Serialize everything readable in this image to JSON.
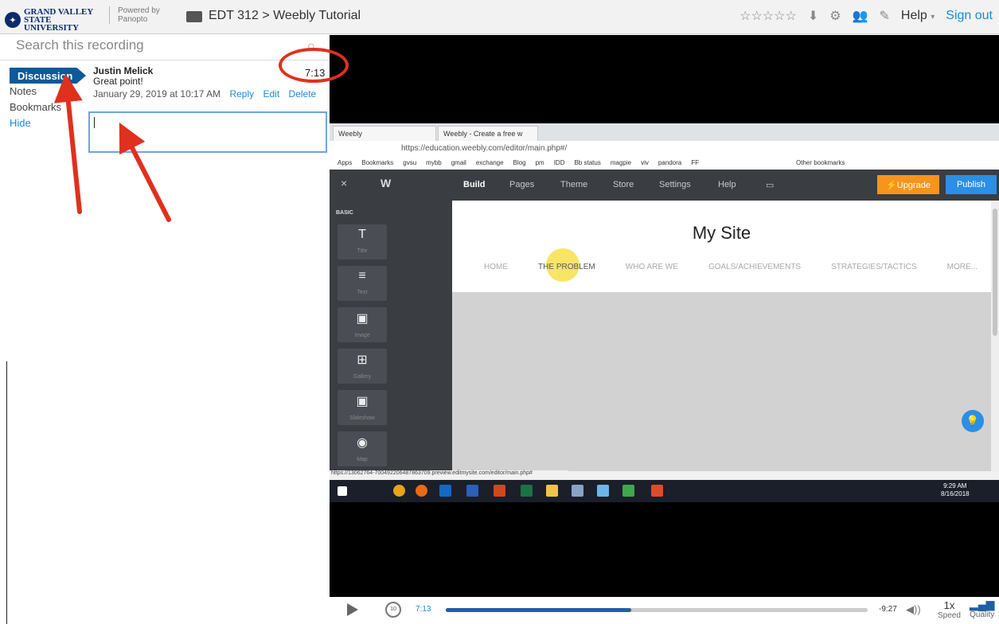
{
  "header": {
    "logo_text": "GRAND VALLEY STATE UNIVERSITY",
    "powered_by": "Powered by Panopto",
    "breadcrumb_parent": "EDT 312",
    "breadcrumb_sep": ">",
    "breadcrumb_current": "Weebly Tutorial",
    "rating_stars": "☆☆☆☆☆",
    "help_label": "Help",
    "signout_label": "Sign out"
  },
  "sidebar": {
    "search_placeholder": "Search this recording",
    "tabs": [
      "Discussion",
      "Notes",
      "Bookmarks",
      "Hide"
    ]
  },
  "discussion": {
    "author": "Justin Melick",
    "text": "Great point!",
    "date": "January 29, 2019 at 10:17 AM",
    "reply_label": "Reply",
    "edit_label": "Edit",
    "delete_label": "Delete",
    "timestamp": "7:13"
  },
  "browser": {
    "tab1": "Weebly",
    "tab2": "Weebly - Create a free w",
    "url": "https://education.weebly.com/editor/main.php#/",
    "bookmarks": [
      "Apps",
      "Bookmarks",
      "gvsu",
      "mybb",
      "gmail",
      "exchange",
      "Blog",
      "pm",
      "IDD",
      "Bb status",
      "magpie",
      "viv",
      "pandora",
      "FF",
      "Other bookmarks"
    ],
    "status_url": "https://13062764-700492206487863709.preview.editmysite.com/editor/main.php#"
  },
  "weebly": {
    "nav": [
      "Build",
      "Pages",
      "Theme",
      "Store",
      "Settings",
      "Help"
    ],
    "upgrade_label": "Upgrade",
    "publish_label": "Publish",
    "section_label": "BASIC",
    "elements": [
      "Title",
      "Text",
      "Image",
      "Gallery",
      "Slideshow",
      "Map"
    ],
    "site_title": "My Site",
    "site_nav": [
      "HOME",
      "THE PROBLEM",
      "WHO ARE WE",
      "GOALS/ACHIEVEMENTS",
      "STRATEGIES/TACTICS",
      "MORE..."
    ]
  },
  "taskbar": {
    "time": "9:29 AM",
    "date": "8/16/2018"
  },
  "player": {
    "current_time": "7:13",
    "remaining": "-9:27",
    "rewind_label": "10",
    "speed_value": "1x",
    "speed_label": "Speed",
    "quality_label": "Quality",
    "progress": 0.44
  },
  "colors": {
    "accent": "#1a8bd1",
    "annotation": "#e0301e",
    "active_tab": "#0b5a9a"
  }
}
